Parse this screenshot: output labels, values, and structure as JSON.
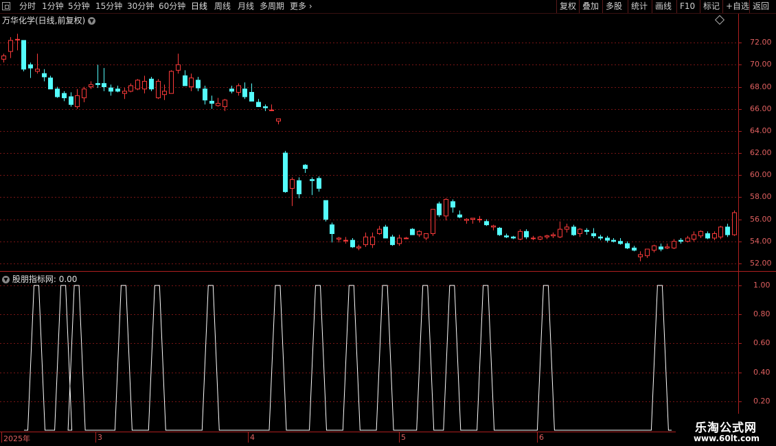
{
  "toolbar": {
    "periods": [
      "分时",
      "1分钟",
      "5分钟",
      "15分钟",
      "30分钟",
      "60分钟",
      "日线",
      "周线",
      "月线",
      "多周期",
      "更多"
    ],
    "active_period": "日线",
    "right_buttons": [
      "复权",
      "叠加",
      "多股",
      "统计",
      "画线",
      "F10",
      "标记",
      "+自选",
      "返回"
    ]
  },
  "main_panel": {
    "title": "万华化学(日线,前复权)",
    "y_ticks": [
      "72.00",
      "70.00",
      "68.00",
      "66.00",
      "64.00",
      "62.00",
      "60.00",
      "58.00",
      "56.00",
      "54.00",
      "52.00"
    ],
    "colors": {
      "up": "#ff3b3b",
      "down": "#54fcfc",
      "grid": "#7a1515",
      "axis": "#b02020"
    }
  },
  "indicator_panel": {
    "title": "股朋指标网",
    "value_text": ": 0.00",
    "y_ticks": [
      "1.00",
      "0.80",
      "0.60",
      "0.40",
      "0.20"
    ],
    "line_color": "#ffffff"
  },
  "date_axis": {
    "labels": [
      "2025年",
      "3",
      "4",
      "5",
      "6"
    ]
  },
  "watermark": {
    "line1": "乐淘公式网",
    "line2": "www.60lt.com"
  },
  "chart_data": [
    {
      "type": "candlestick",
      "title": "万华化学(日线,前复权)",
      "ylim": [
        51.5,
        73.5
      ],
      "ohlc": [
        [
          70.5,
          71.0,
          70.2,
          70.8
        ],
        [
          71.2,
          72.5,
          70.6,
          72.2
        ],
        [
          72.3,
          72.8,
          71.3,
          72.3
        ],
        [
          72.2,
          72.2,
          69.4,
          69.6
        ],
        [
          70.0,
          70.2,
          68.8,
          69.7
        ],
        [
          69.4,
          71.0,
          69.2,
          69.6
        ],
        [
          69.2,
          69.6,
          68.5,
          68.9
        ],
        [
          68.8,
          69.0,
          67.8,
          67.8
        ],
        [
          67.8,
          68.0,
          67.0,
          67.1
        ],
        [
          67.4,
          67.6,
          66.7,
          67.0
        ],
        [
          67.1,
          67.5,
          66.2,
          66.4
        ],
        [
          66.2,
          67.8,
          66.0,
          67.2
        ],
        [
          67.0,
          68.0,
          66.6,
          67.8
        ],
        [
          68.0,
          68.5,
          67.8,
          68.2
        ],
        [
          68.3,
          70.0,
          67.9,
          68.2
        ],
        [
          68.3,
          69.7,
          67.6,
          68.0
        ],
        [
          67.9,
          68.2,
          67.2,
          67.6
        ],
        [
          67.8,
          68.1,
          67.5,
          67.6
        ],
        [
          67.4,
          67.9,
          66.9,
          67.6
        ],
        [
          67.6,
          68.3,
          67.5,
          68.1
        ],
        [
          67.8,
          68.7,
          67.7,
          68.6
        ],
        [
          67.8,
          69.0,
          67.4,
          68.5
        ],
        [
          68.7,
          68.9,
          67.6,
          67.8
        ],
        [
          67.0,
          68.7,
          66.9,
          68.5
        ],
        [
          67.3,
          68.2,
          66.8,
          67.6
        ],
        [
          67.4,
          69.5,
          67.4,
          69.4
        ],
        [
          69.5,
          71.0,
          69.2,
          70.0
        ],
        [
          69.0,
          69.5,
          68.2,
          68.1
        ],
        [
          68.0,
          69.2,
          67.6,
          68.8
        ],
        [
          68.6,
          68.9,
          67.6,
          67.9
        ],
        [
          67.8,
          68.1,
          66.4,
          66.8
        ],
        [
          66.7,
          67.2,
          66.0,
          66.5
        ],
        [
          66.3,
          67.0,
          66.2,
          66.5
        ],
        [
          66.2,
          66.9,
          65.8,
          66.8
        ],
        [
          67.8,
          68.1,
          67.4,
          67.6
        ],
        [
          67.5,
          68.3,
          67.2,
          68.1
        ],
        [
          67.8,
          68.4,
          66.9,
          67.1
        ],
        [
          67.5,
          68.3,
          66.8,
          66.7
        ],
        [
          66.6,
          66.9,
          66.4,
          66.2
        ],
        [
          66.2,
          66.4,
          65.8,
          66.1
        ],
        [
          65.9,
          66.4,
          65.8,
          65.9
        ],
        [
          64.9,
          65.1,
          64.6,
          65.1
        ],
        [
          62.0,
          62.2,
          58.4,
          58.5
        ],
        [
          58.8,
          59.8,
          57.2,
          59.6
        ],
        [
          59.5,
          59.8,
          57.9,
          58.3
        ],
        [
          60.9,
          61.0,
          60.2,
          60.6
        ],
        [
          59.6,
          59.8,
          58.2,
          59.5
        ],
        [
          59.7,
          59.9,
          58.5,
          58.8
        ],
        [
          57.7,
          57.7,
          55.8,
          56.0
        ],
        [
          55.5,
          55.7,
          53.9,
          54.7
        ],
        [
          54.2,
          54.4,
          53.9,
          54.3
        ],
        [
          54.1,
          54.4,
          53.8,
          54.1
        ],
        [
          54.1,
          54.3,
          53.4,
          53.5
        ],
        [
          53.4,
          53.7,
          53.2,
          53.5
        ],
        [
          53.7,
          54.8,
          53.5,
          54.4
        ],
        [
          53.7,
          54.8,
          53.4,
          54.4
        ],
        [
          54.7,
          55.4,
          54.6,
          55.1
        ],
        [
          55.3,
          55.5,
          54.5,
          54.3
        ],
        [
          54.4,
          54.6,
          53.6,
          53.7
        ],
        [
          53.8,
          54.6,
          53.6,
          54.3
        ],
        [
          54.3,
          54.4,
          54.2,
          54.3
        ],
        [
          55.1,
          55.2,
          54.7,
          54.6
        ],
        [
          54.6,
          55.0,
          54.4,
          54.9
        ],
        [
          54.3,
          54.6,
          54.1,
          54.7
        ],
        [
          54.7,
          56.8,
          54.5,
          56.9
        ],
        [
          57.4,
          57.6,
          56.2,
          56.4
        ],
        [
          56.3,
          57.9,
          55.9,
          57.8
        ],
        [
          57.6,
          57.8,
          56.6,
          57.1
        ],
        [
          56.4,
          56.8,
          56.1,
          56.2
        ],
        [
          55.9,
          56.1,
          55.6,
          56.0
        ],
        [
          56.0,
          56.1,
          55.6,
          56.1
        ],
        [
          56.0,
          56.3,
          55.7,
          56.0
        ],
        [
          55.8,
          56.0,
          55.4,
          55.5
        ],
        [
          55.3,
          55.5,
          55.0,
          55.4
        ],
        [
          55.2,
          55.3,
          54.5,
          54.6
        ],
        [
          54.5,
          54.7,
          54.3,
          54.4
        ],
        [
          54.4,
          54.5,
          54.2,
          54.3
        ],
        [
          54.2,
          55.1,
          54.1,
          54.9
        ],
        [
          54.9,
          55.1,
          54.2,
          54.4
        ],
        [
          54.3,
          54.5,
          54.1,
          54.3
        ],
        [
          54.2,
          54.5,
          54.1,
          54.4
        ],
        [
          54.4,
          54.6,
          54.2,
          54.5
        ],
        [
          54.5,
          54.8,
          54.3,
          54.6
        ],
        [
          54.4,
          55.8,
          54.3,
          55.1
        ],
        [
          55.1,
          55.6,
          54.8,
          55.3
        ],
        [
          55.3,
          55.5,
          54.5,
          54.6
        ],
        [
          54.7,
          55.2,
          54.4,
          55.1
        ],
        [
          55.0,
          55.2,
          54.6,
          54.9
        ],
        [
          54.7,
          55.2,
          54.3,
          54.5
        ],
        [
          54.4,
          54.6,
          54.1,
          54.3
        ],
        [
          54.3,
          54.5,
          53.9,
          54.1
        ],
        [
          54.1,
          54.3,
          53.9,
          54.0
        ],
        [
          54.0,
          54.3,
          53.7,
          53.8
        ],
        [
          53.8,
          54.0,
          53.3,
          53.4
        ],
        [
          53.4,
          53.6,
          53.1,
          53.2
        ],
        [
          52.6,
          53.1,
          52.2,
          52.8
        ],
        [
          52.7,
          53.3,
          52.5,
          53.3
        ],
        [
          53.2,
          53.7,
          53.0,
          53.6
        ],
        [
          53.5,
          53.8,
          53.1,
          53.3
        ],
        [
          53.4,
          53.8,
          53.3,
          53.5
        ],
        [
          53.4,
          54.2,
          53.3,
          54.0
        ],
        [
          54.1,
          54.3,
          53.8,
          54.0
        ],
        [
          54.0,
          54.5,
          53.9,
          54.3
        ],
        [
          54.2,
          54.9,
          54.0,
          54.6
        ],
        [
          54.5,
          55.0,
          54.3,
          54.9
        ],
        [
          54.7,
          54.9,
          54.2,
          54.3
        ],
        [
          54.3,
          54.9,
          54.1,
          54.7
        ],
        [
          54.4,
          55.4,
          54.2,
          55.3
        ],
        [
          55.3,
          55.6,
          54.4,
          54.6
        ],
        [
          54.6,
          56.8,
          54.5,
          56.6
        ]
      ]
    },
    {
      "type": "line",
      "title": "股朋指标网",
      "ylim": [
        0,
        1.05
      ],
      "y_ticks": [
        1.0,
        0.8,
        0.6,
        0.4,
        0.2
      ],
      "signal_pulses_at_bar_index": [
        4,
        8,
        10,
        17,
        22,
        30,
        40,
        46,
        51,
        56,
        62,
        66,
        71,
        80,
        97
      ]
    }
  ]
}
